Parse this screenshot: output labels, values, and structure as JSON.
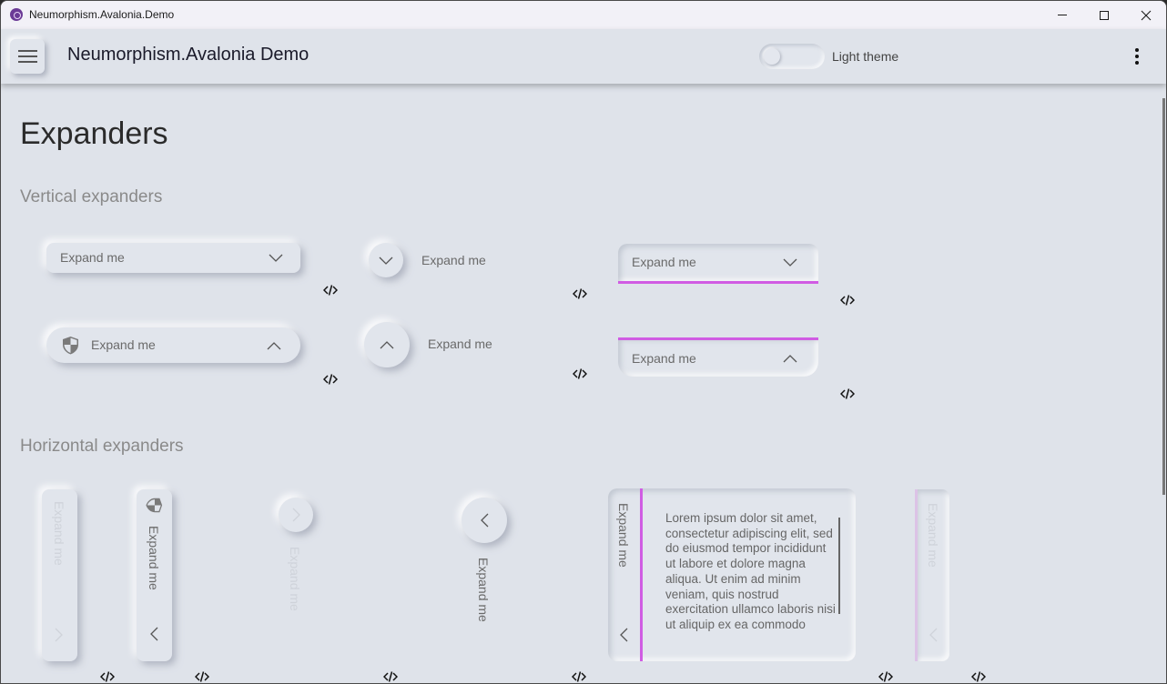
{
  "window": {
    "title": "Neumorphism.Avalonia.Demo",
    "controls": [
      "minimize",
      "maximize",
      "close"
    ]
  },
  "appbar": {
    "menu_icon": "hamburger-icon",
    "title": "Neumorphism.Avalonia Demo",
    "theme_toggle": {
      "label": "Light theme",
      "checked": false
    },
    "more_icon": "more-vertical-icon"
  },
  "page": {
    "title": "Expanders",
    "sections": {
      "vertical": {
        "title": "Vertical expanders",
        "expanders": [
          {
            "header": "Expand me",
            "style": "raised-rect",
            "state": "collapsed",
            "icon": null,
            "code_icon": "code-icon"
          },
          {
            "header": "Expand me",
            "style": "raised-pill",
            "state": "expanded",
            "icon": "shield-icon",
            "code_icon": "code-icon"
          },
          {
            "header": "Expand me",
            "style": "circle-button",
            "state": "collapsed",
            "code_icon": "code-icon"
          },
          {
            "header": "Expand me",
            "style": "circle-button",
            "state": "expanded",
            "code_icon": "code-icon"
          },
          {
            "header": "Expand me",
            "style": "accent-underline",
            "state": "collapsed",
            "direction": "down",
            "code_icon": "code-icon"
          },
          {
            "header": "Expand me",
            "style": "accent-underline",
            "state": "expanded",
            "direction": "up",
            "code_icon": "code-icon"
          }
        ]
      },
      "horizontal": {
        "title": "Horizontal expanders",
        "expanders": [
          {
            "header": "Expand me",
            "style": "raised-bar",
            "enabled": false,
            "state": "collapsed",
            "code_icon": "code-icon"
          },
          {
            "header": "Expand me",
            "style": "raised-bar",
            "enabled": true,
            "state": "expanded",
            "icon": "shield-icon",
            "code_icon": "code-icon"
          },
          {
            "header": "Expand me",
            "style": "circle-button",
            "enabled": false,
            "state": "collapsed",
            "code_icon": "code-icon"
          },
          {
            "header": "Expand me",
            "style": "circle-button",
            "enabled": true,
            "state": "expanded",
            "code_icon": "code-icon"
          },
          {
            "header": "Expand me",
            "style": "accent-side",
            "enabled": true,
            "state": "expanded",
            "content": "Lorem ipsum dolor sit amet, consectetur adipiscing elit, sed do eiusmod tempor incididunt ut labore et dolore magna aliqua. Ut enim ad minim veniam, quis nostrud exercitation ullamco laboris nisi ut aliquip ex ea commodo",
            "code_icon": "code-icon"
          },
          {
            "header": "Expand me",
            "style": "accent-side",
            "enabled": false,
            "state": "collapsed",
            "code_icon": "code-icon"
          }
        ]
      }
    }
  },
  "colors": {
    "background": "#dfe3ea",
    "accent": "#d05ce3",
    "accent_disabled": "#dcc2e6",
    "text_primary": "#2b2b2b",
    "text_secondary": "#6a6a6a",
    "section_heading": "#8a8a8a"
  }
}
